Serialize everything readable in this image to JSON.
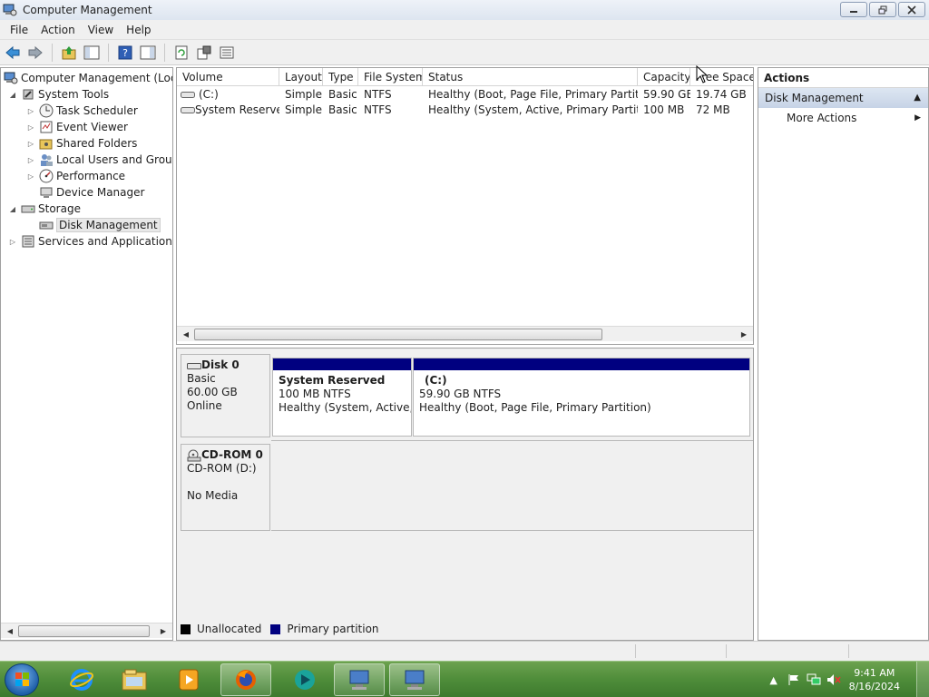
{
  "window": {
    "title": "Computer Management"
  },
  "menu": [
    "File",
    "Action",
    "View",
    "Help"
  ],
  "toolbar_icons": [
    "back-icon",
    "forward-icon",
    "up-icon",
    "show-hide-tree-icon",
    "help-icon",
    "show-hide-action-pane-icon",
    "refresh-icon",
    "properties-icon",
    "export-icon"
  ],
  "tree": {
    "root": "Computer Management (Local",
    "items": [
      {
        "label": "System Tools",
        "icon": "system-tools-icon"
      },
      {
        "label": "Task Scheduler",
        "icon": "clock-icon"
      },
      {
        "label": "Event Viewer",
        "icon": "event-viewer-icon"
      },
      {
        "label": "Shared Folders",
        "icon": "shared-folders-icon"
      },
      {
        "label": "Local Users and Groups",
        "icon": "users-icon"
      },
      {
        "label": "Performance",
        "icon": "performance-icon"
      },
      {
        "label": "Device Manager",
        "icon": "device-manager-icon"
      },
      {
        "label": "Storage",
        "icon": "storage-icon"
      },
      {
        "label": "Disk Management",
        "icon": "disk-icon"
      },
      {
        "label": "Services and Applications",
        "icon": "services-icon"
      }
    ]
  },
  "volumes": {
    "columns": [
      "Volume",
      "Layout",
      "Type",
      "File System",
      "Status",
      "Capacity",
      "Free Space"
    ],
    "rows": [
      [
        "(C:)",
        "Simple",
        "Basic",
        "NTFS",
        "Healthy (Boot, Page File, Primary Partition)",
        "59.90 GB",
        "19.74 GB"
      ],
      [
        "System Reserved",
        "Simple",
        "Basic",
        "NTFS",
        "Healthy (System, Active, Primary Partition)",
        "100 MB",
        "72 MB"
      ]
    ]
  },
  "disks": {
    "disk0": {
      "name": "Disk 0",
      "type": "Basic",
      "size": "60.00 GB",
      "state": "Online",
      "partitions": [
        {
          "name": "System Reserved",
          "size": "100 MB NTFS",
          "status": "Healthy (System, Active, P"
        },
        {
          "name": "(C:)",
          "size": "59.90 GB NTFS",
          "status": "Healthy (Boot, Page File, Primary Partition)"
        }
      ]
    },
    "cdrom0": {
      "name": "CD-ROM 0",
      "drive": "CD-ROM (D:)",
      "media": "No Media"
    }
  },
  "legend": [
    {
      "label": "Unallocated",
      "color": "#000000"
    },
    {
      "label": "Primary partition",
      "color": "#000080"
    }
  ],
  "actions": {
    "header": "Actions",
    "section": "Disk Management",
    "items": [
      "More Actions"
    ]
  },
  "taskbar": {
    "apps": [
      "internet-explorer-icon",
      "windows-explorer-icon",
      "media-player-icon",
      "firefox-icon",
      "app-icon",
      "computer-management-icon",
      "computer-management-icon-2"
    ],
    "time": "9:41 AM",
    "date": "8/16/2024"
  },
  "colors": {
    "primary_partition": "#000080",
    "selection": "#e8e8e8",
    "taskbar": "#4f8d3a"
  }
}
